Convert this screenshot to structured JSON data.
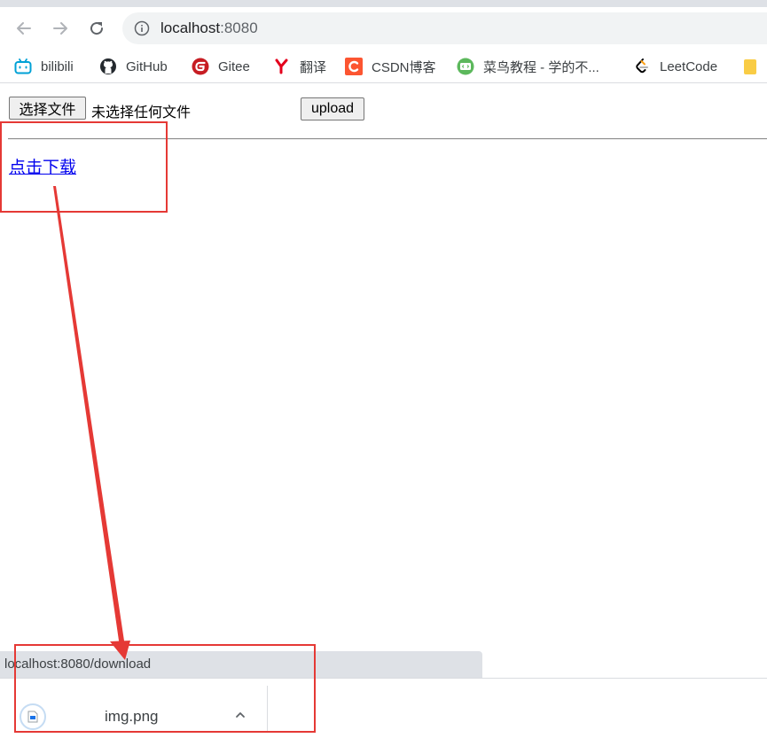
{
  "browser": {
    "url": "localhost:8080",
    "url_host": "localhost",
    "url_port": ":8080"
  },
  "bookmarks": [
    {
      "label": "bilibili",
      "icon": "bilibili-icon",
      "color": "#00a1d6"
    },
    {
      "label": "GitHub",
      "icon": "github-icon",
      "color": "#24292e"
    },
    {
      "label": "Gitee",
      "icon": "gitee-icon",
      "color": "#c71d23"
    },
    {
      "label": "翻译",
      "icon": "youdao-icon",
      "color": "#e4001c"
    },
    {
      "label": "CSDN博客",
      "icon": "csdn-icon",
      "color": "#fc5531"
    },
    {
      "label": "菜鸟教程 - 学的不...",
      "icon": "runoob-icon",
      "color": "#5cb85c"
    },
    {
      "label": "LeetCode",
      "icon": "leetcode-icon",
      "color": "#ffa116"
    }
  ],
  "page": {
    "file_button_label": "选择文件",
    "no_file_text": "未选择任何文件",
    "upload_button_label": "upload",
    "download_link_text": "点击下载"
  },
  "status": {
    "hover_url": "localhost:8080/download"
  },
  "download_shelf": {
    "file_name": "img.png"
  },
  "colors": {
    "annotation": "#e53935",
    "link": "#0000ee"
  }
}
